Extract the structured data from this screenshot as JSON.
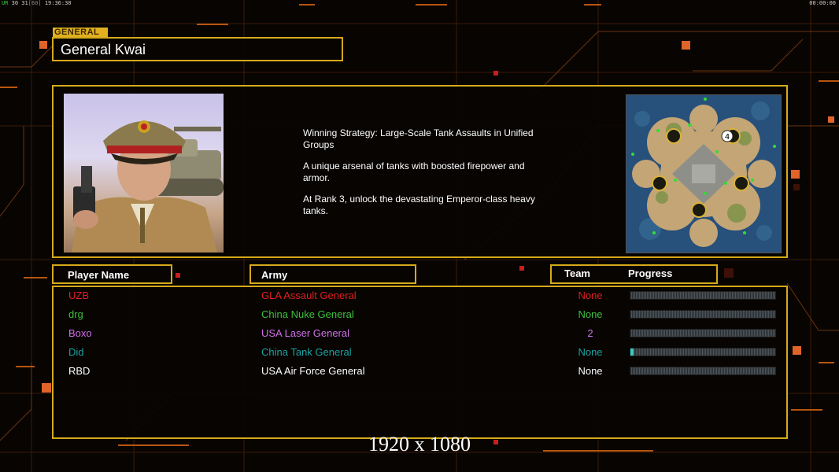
{
  "hud": {
    "ur_label": "UR",
    "fps_values": "30 31",
    "fps_limit": "[60]",
    "clock": "19:36:30",
    "timer": "00:00:00"
  },
  "general": {
    "tag": "GENERAL",
    "name": "General Kwai",
    "strategy": [
      "Winning Strategy: Large-Scale Tank Assaults in Unified\n Groups",
      "A unique arsenal of tanks with boosted firepower and\n armor.",
      "At Rank 3, unlock the devastating Emperor-class heavy\n tanks."
    ],
    "minimap_player_count": "4"
  },
  "columns": {
    "player": "Player Name",
    "army": "Army",
    "team": "Team",
    "progress": "Progress"
  },
  "players": [
    {
      "name": "UZB",
      "army": "GLA Assault General",
      "team": "None",
      "color": "#e01e1e",
      "progress": 0
    },
    {
      "name": "drg",
      "army": "China Nuke General",
      "team": "None",
      "color": "#3cc03c",
      "progress": 0
    },
    {
      "name": "Boxo",
      "army": "USA Laser General",
      "team": "2",
      "color": "#d070e8",
      "progress": 0
    },
    {
      "name": "Did",
      "army": "China Tank General",
      "team": "None",
      "color": "#1aa3a3",
      "progress": 0.02
    },
    {
      "name": "RBD",
      "army": "USA Air Force General",
      "team": "None",
      "color": "#ffffff",
      "progress": 0
    }
  ],
  "accent_color": "#d6a91a",
  "overlay": {
    "resolution": "1920 x 1080"
  }
}
